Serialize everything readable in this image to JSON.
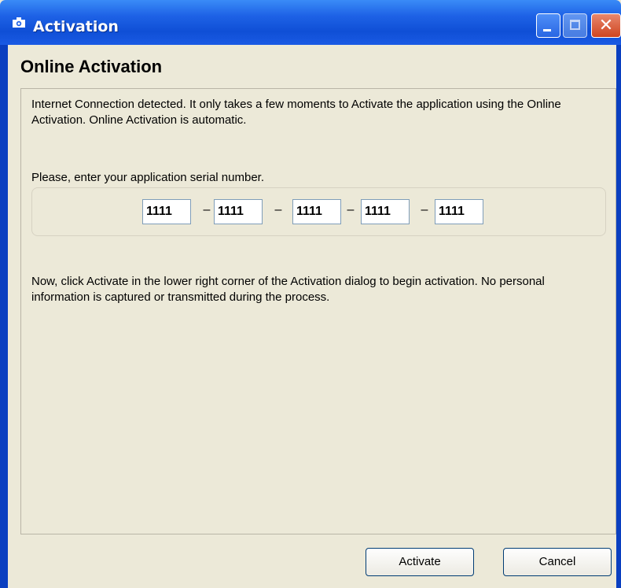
{
  "window": {
    "title": "Activation",
    "icon": "camera-icon",
    "controls": [
      "minimize-icon",
      "maximize-icon",
      "close-icon"
    ],
    "colors": {
      "titlebar": "#1e62e6",
      "frame": "#0a3fc0",
      "body": "#ece9d8",
      "close": "#cf4520"
    }
  },
  "page": {
    "heading": "Online Activation",
    "intro": "Internet Connection detected. It only takes a few moments to Activate the application using the Online Activation. Online Activation is automatic.",
    "serial_prompt": "Please, enter your application serial number.",
    "serial": {
      "parts": [
        "1111",
        "1111",
        "1111",
        "1111",
        "1111"
      ],
      "separator": "–"
    },
    "instructions": "Now, click Activate in the lower right corner of the Activation dialog to begin activation. No personal information is captured or transmitted during the process."
  },
  "buttons": {
    "activate": "Activate",
    "cancel": "Cancel"
  }
}
